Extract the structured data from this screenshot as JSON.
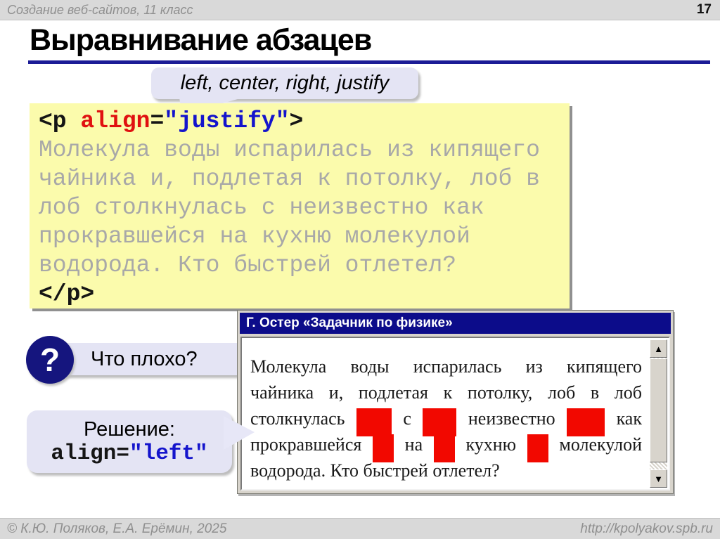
{
  "header": {
    "course_label": "Создание веб-сайтов, 11 класс",
    "page_number": "17"
  },
  "slide": {
    "title": "Выравнивание абзацев"
  },
  "align_callout": {
    "text": "left, center, right, justify"
  },
  "code_block": {
    "lines": [
      {
        "segs": [
          {
            "t": "<p ",
            "c": "k"
          },
          {
            "t": "align",
            "c": "r"
          },
          {
            "t": "=",
            "c": "k"
          },
          {
            "t": "\"justify\"",
            "c": "b"
          },
          {
            "t": ">",
            "c": "k"
          }
        ]
      },
      {
        "segs": [
          {
            "t": "Молекула воды испарилась из кипящего",
            "c": "g"
          }
        ]
      },
      {
        "segs": [
          {
            "t": "чайника и, подлетая к потолку, лоб в",
            "c": "g"
          }
        ]
      },
      {
        "segs": [
          {
            "t": "лоб столкнулась с неизвестно как",
            "c": "g"
          }
        ]
      },
      {
        "segs": [
          {
            "t": "прокравшейся на кухню молекулой",
            "c": "g"
          }
        ]
      },
      {
        "segs": [
          {
            "t": "водорода. Кто быстрей отлетел?",
            "c": "g"
          }
        ]
      },
      {
        "segs": [
          {
            "t": "</p>",
            "c": "k"
          }
        ]
      }
    ]
  },
  "question": {
    "icon_glyph": "?",
    "label": "Что плохо?"
  },
  "solution": {
    "label": "Решение:",
    "code_attr": "align=",
    "code_value": "\"left\""
  },
  "viewer_window": {
    "title": "Г. Остер «Задачник по физике»",
    "lines": [
      {
        "justify": true,
        "tokens": [
          {
            "w": "Молекула"
          },
          {
            "w": "воды"
          },
          {
            "w": "испарилась"
          },
          {
            "w": "из"
          },
          {
            "w": "кипящего"
          }
        ]
      },
      {
        "justify": true,
        "tokens": [
          {
            "w": "чайника"
          },
          {
            "w": "и,"
          },
          {
            "w": "подлетая"
          },
          {
            "w": "к"
          },
          {
            "w": "потолку,"
          },
          {
            "w": "лоб"
          },
          {
            "w": "в"
          },
          {
            "w": "лоб"
          }
        ]
      },
      {
        "justify": true,
        "tokens": [
          {
            "w": "столкнулась"
          },
          {
            "gap": 50
          },
          {
            "w": "с"
          },
          {
            "gap": 48
          },
          {
            "w": "неизвестно"
          },
          {
            "gap": 54
          },
          {
            "w": "как"
          }
        ]
      },
      {
        "justify": true,
        "tokens": [
          {
            "w": "прокравшейся"
          },
          {
            "gap": 30
          },
          {
            "w": "на"
          },
          {
            "gap": 30
          },
          {
            "w": "кухню"
          },
          {
            "gap": 30
          },
          {
            "w": "молекулой"
          }
        ]
      },
      {
        "justify": false,
        "tokens": [
          {
            "w": "водорода. Кто быстрей отлетел?"
          }
        ]
      }
    ],
    "scrollbar": {
      "up_icon": "▲",
      "down_icon": "▼"
    }
  },
  "footer": {
    "copyright": "© К.Ю. Поляков, Е.А. Ерёмин, 2025",
    "url": "http://kpolyakov.spb.ru"
  },
  "colors": {
    "navy": "#1b1b96",
    "titlebar": "#0c0c8a",
    "navy_circle": "#15157e",
    "yellow": "#fbfbac",
    "lavender": "#e4e4f4",
    "red": "#f20800",
    "gray_bar": "#d9d9d9",
    "bar_text": "#8f8f8f",
    "code_gray": "#a8a8a8",
    "code_red": "#e01010",
    "code_blue": "#1414cc"
  }
}
